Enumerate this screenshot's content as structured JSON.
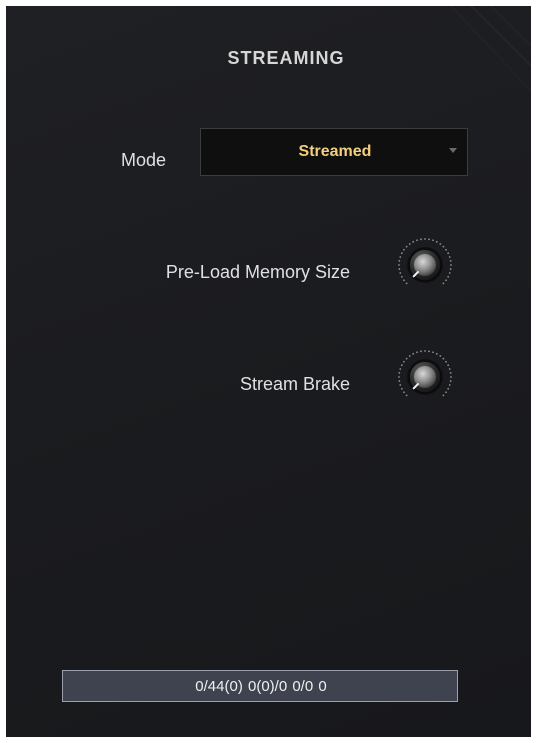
{
  "panel": {
    "title": "STREAMING"
  },
  "mode": {
    "label": "Mode",
    "selected": "Streamed"
  },
  "controls": {
    "preload_label": "Pre-Load Memory Size",
    "brake_label": "Stream Brake"
  },
  "knobs": {
    "preload_level": 0.0,
    "brake_level": 0.0,
    "icon": "rotary-knob-icon"
  },
  "status": {
    "text": "0/44(0) 0(0)/0  0/0 0"
  },
  "colors": {
    "background": "#1c1d20",
    "accent_value": "#f3d07a",
    "label": "#e0e0e0",
    "status_bar": "#3f4350"
  }
}
